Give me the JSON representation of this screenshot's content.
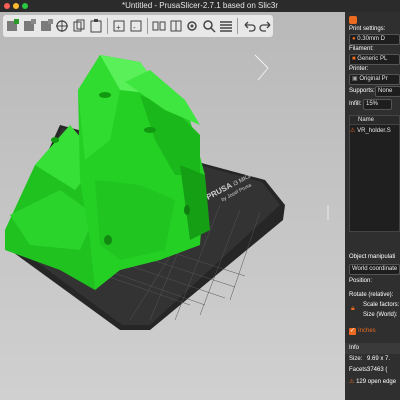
{
  "window": {
    "title": "*Untitled - PrusaSlicer-2.7.1 based on Slic3r"
  },
  "bed": {
    "brand": "PRUSA",
    "model": "i3 MK3",
    "author": "by Josef Prusa"
  },
  "sidebar": {
    "print_settings_label": "Print settings:",
    "print_profile": "0.30mm D",
    "filament_label": "Filament:",
    "filament_profile": "Generic PL",
    "printer_label": "Printer:",
    "printer_profile": "Original Pr",
    "supports_label": "Supports:",
    "supports_value": "None",
    "infill_label": "Infill:",
    "infill_value": "15%",
    "object_list_header": "Name",
    "object_name": "VR_holder.S",
    "object_manip_label": "Object manipulati",
    "coord_select": "World coordinate",
    "position_label": "Position:",
    "rotate_label": "Rotate (relative):",
    "scale_label": "Scale factors:",
    "size_label": "Size (World):",
    "inches_label": "Inches",
    "info_label": "Info",
    "size_info_label": "Size:",
    "size_info_value": "9.69 x 7.",
    "facets_label": "Facets:",
    "facets_value": "37463 (",
    "warning_text": "129 open edge"
  },
  "colors": {
    "accent": "#ed6b21",
    "model": "#22dd22",
    "bed": "#2a2a2a",
    "panel": "#2f2f2f"
  }
}
